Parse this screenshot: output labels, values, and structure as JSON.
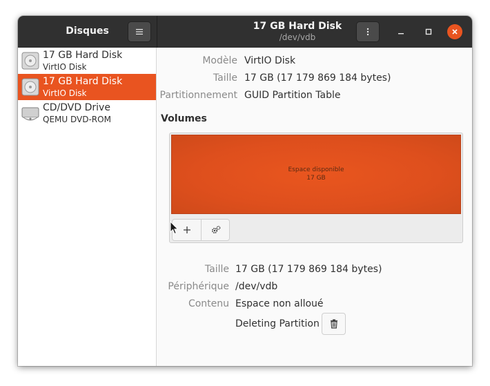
{
  "header": {
    "left_title": "Disques",
    "title": "17 GB Hard Disk",
    "subtitle": "/dev/vdb",
    "menu_icon": "hamburger-icon",
    "kebab_icon": "kebab-icon",
    "close_color": "#e95420"
  },
  "sidebar": {
    "items": [
      {
        "name": "17 GB Hard Disk",
        "sub": "VirtIO Disk",
        "icon": "hard-disk-icon"
      },
      {
        "name": "17 GB Hard Disk",
        "sub": "VirtIO Disk",
        "icon": "hard-disk-icon",
        "selected": true
      },
      {
        "name": "CD/DVD Drive",
        "sub": "QEMU DVD-ROM",
        "icon": "optical-drive-icon"
      }
    ],
    "selected_color": "#e95420"
  },
  "disk_props": {
    "model_label": "Modèle",
    "model_value": "VirtIO Disk",
    "size_label": "Taille",
    "size_value": "17 GB (17 179 869 184 bytes)",
    "partitioning_label": "Partitionnement",
    "partitioning_value": "GUID Partition Table"
  },
  "volumes": {
    "title": "Volumes",
    "partition_label": "Espace disponible",
    "partition_size": "17 GB",
    "partition_color": "#e95420",
    "add_icon": "plus-icon",
    "settings_icon": "gears-icon"
  },
  "volume_props": {
    "size_label": "Taille",
    "size_value": "17 GB (17 179 869 184 bytes)",
    "device_label": "Périphérique",
    "device_value": "/dev/vdb",
    "content_label": "Contenu",
    "content_value": "Espace non alloué",
    "status_value": "Deleting Partition",
    "delete_icon": "trash-icon"
  }
}
